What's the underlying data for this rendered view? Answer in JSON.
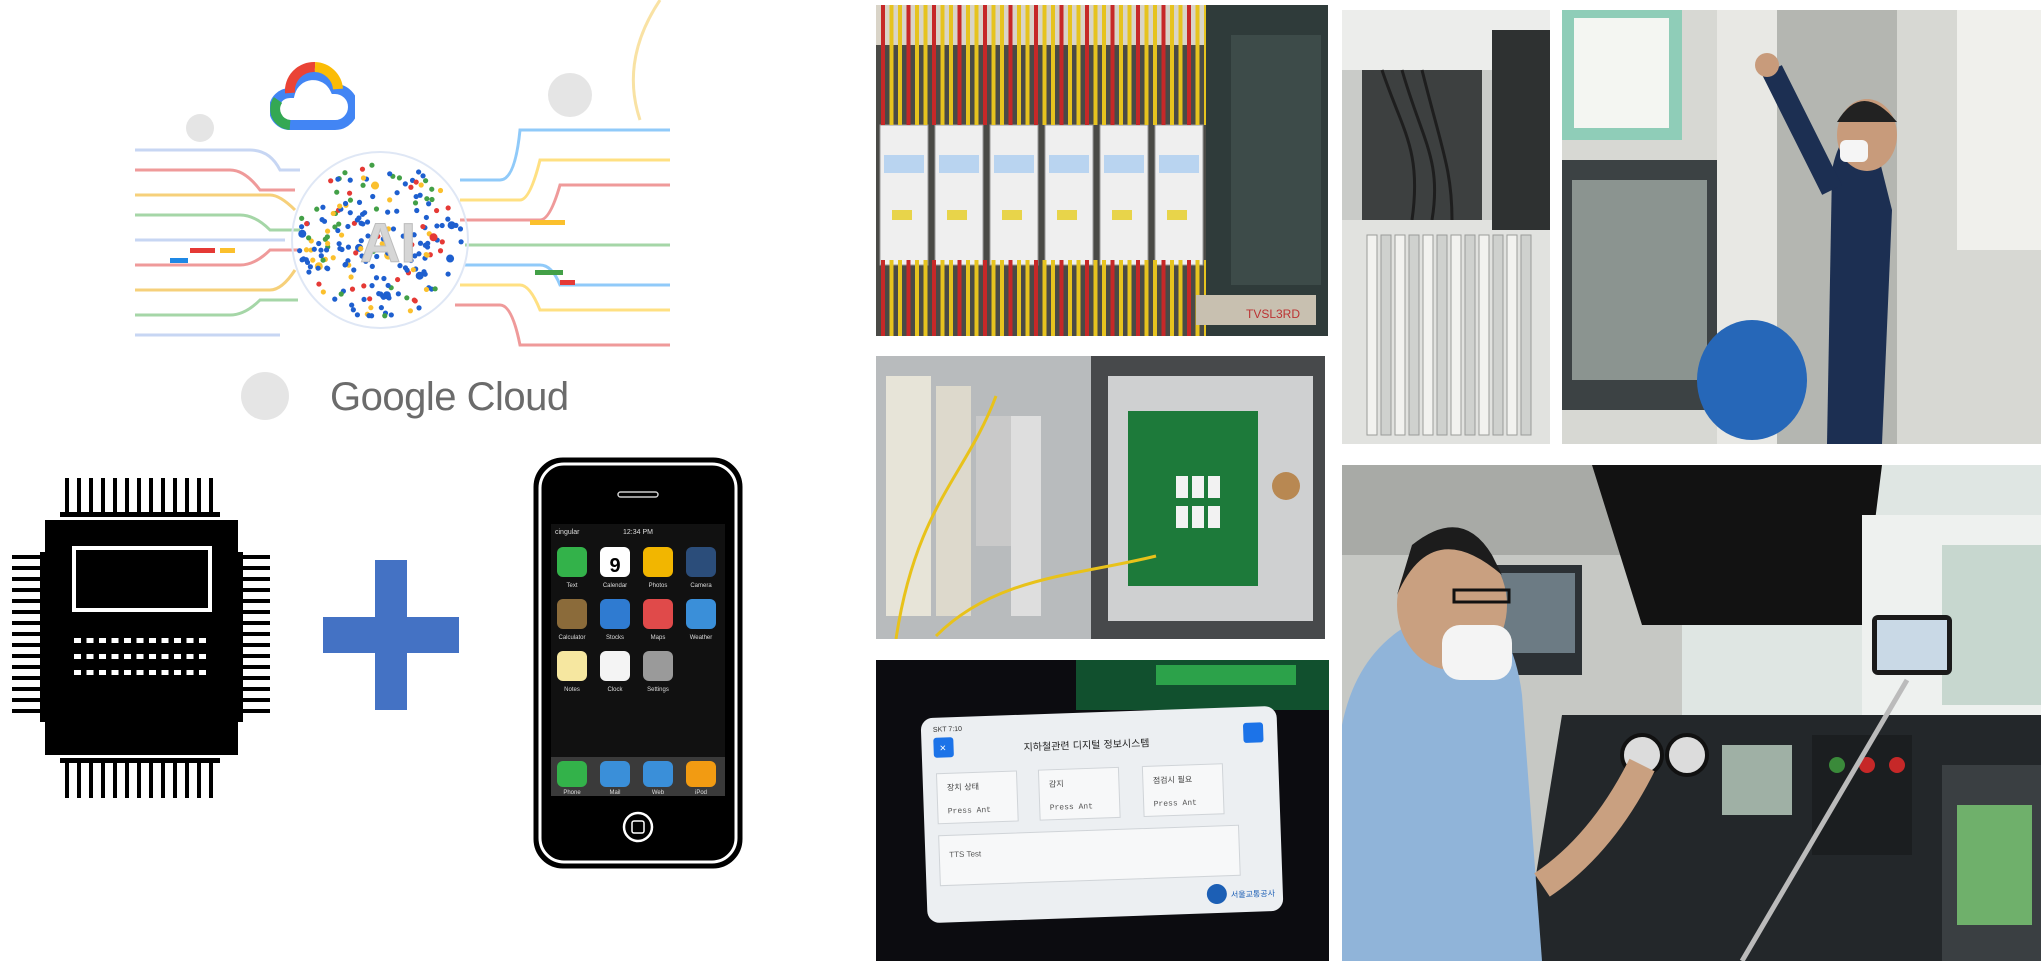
{
  "left_panel": {
    "brand_text": "Google Cloud",
    "ai_label": "AI",
    "icons": [
      "google-cloud-logo",
      "ai-brain-icon",
      "microcontroller-chip-icon",
      "plus-icon",
      "smartphone-icon"
    ],
    "phone": {
      "carrier": "cingular",
      "time": "12:34 PM",
      "apps": [
        "Text",
        "Calendar",
        "Photos",
        "Camera",
        "Calculator",
        "Stocks",
        "Maps",
        "Weather",
        "Notes",
        "Clock",
        "Settings"
      ],
      "dock": [
        "Phone",
        "Mail",
        "Web",
        "iPod"
      ],
      "calendar_day": "9"
    },
    "colors": {
      "plus": "#4472c4",
      "chip": "#000000"
    }
  },
  "photos": {
    "p1": {
      "subject": "electrical relay panel",
      "tag_text": "TVSL3RD"
    },
    "p2": {
      "subject": "control box with circuit board"
    },
    "p3": {
      "subject": "tablet showing monitoring app",
      "status_time": "SKT 7:10",
      "app_title": "지하철관련 디지털 정보시스템",
      "fields": [
        "장치 상태",
        "감지",
        "점검시 필요"
      ],
      "field_values": [
        "Press Ant",
        "Press Ant",
        "Press Ant"
      ],
      "text_area_label": "TTS Test",
      "footer_logo": "서울교통공사"
    },
    "p4": {
      "subject": "equipment racks"
    },
    "p5": {
      "subject": "worker adjusting equipment"
    },
    "p6": {
      "subject": "operator in train cab with phone mount"
    }
  }
}
